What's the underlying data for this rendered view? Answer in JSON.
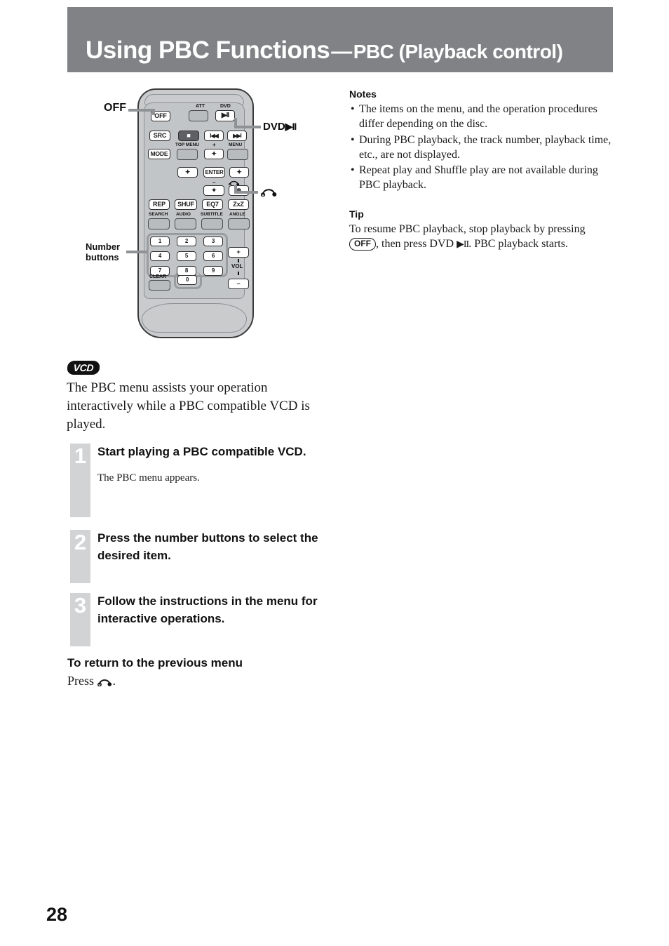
{
  "header": {
    "title_main": "Using PBC Functions",
    "dash": "—",
    "title_sub": "PBC (Playback control)",
    "band_color": "#808285"
  },
  "remote": {
    "callouts": {
      "off": "OFF",
      "number_buttons_line1": "Number",
      "number_buttons_line2": "buttons",
      "dvd_play": "DVD",
      "dvd_play_glyph": "▶II",
      "return_icon": "return-arrow-icon"
    },
    "buttons": {
      "off": "OFF",
      "att": "ATT",
      "dvd": "DVD",
      "dvd_glyph": "▶II",
      "src": "SRC",
      "stop_glyph": "■",
      "prev_glyph": "I◀◀",
      "next_glyph": "▶▶I",
      "top_menu": "TOP MENU",
      "menu": "MENU",
      "mode": "MODE",
      "up_glyph": "✦",
      "plus": "+",
      "minus": "–",
      "left_glyph": "✦",
      "right_glyph": "✦",
      "enter": "ENTER",
      "down_glyph": "✦",
      "rep": "REP",
      "shuf": "SHUF",
      "eq7": "EQ7",
      "zxz": "ZxZ",
      "search": "SEARCH",
      "audio": "AUDIO",
      "subtitle": "SUBTITLE",
      "angle": "ANGLE",
      "clear": "CLEAR",
      "vol": "VOL",
      "vol_up": "+",
      "vol_down": "–",
      "numbers": [
        "1",
        "2",
        "3",
        "4",
        "5",
        "6",
        "7",
        "8",
        "9",
        "0"
      ]
    }
  },
  "notes": {
    "heading": "Notes",
    "items": [
      "The items on the menu, and the operation procedures differ depending on the disc.",
      "During PBC playback, the track number, playback time, etc., are not displayed.",
      "Repeat play and Shuffle play are not available during PBC playback."
    ],
    "bullet": "•"
  },
  "tip": {
    "heading": "Tip",
    "line1": "To resume PBC playback, stop playback by pressing",
    "off_pill": "OFF",
    "line2_a": ", then press DVD ",
    "line2_glyph": "▶II",
    "line2_b": ". PBC playback starts."
  },
  "intro": {
    "badge": "VCD",
    "text": "The PBC menu assists your operation interactively while a PBC compatible VCD is played."
  },
  "steps": [
    {
      "number": "1",
      "title": "Start playing a PBC compatible VCD.",
      "note": "The PBC menu appears."
    },
    {
      "number": "2",
      "title": "Press the number buttons to select the desired item.",
      "note": ""
    },
    {
      "number": "3",
      "title": "Follow the instructions in the menu for interactive operations.",
      "note": ""
    }
  ],
  "return_section": {
    "heading": "To return to the previous menu",
    "body_prefix": "Press ",
    "body_suffix": "."
  },
  "page": {
    "number": "28"
  }
}
